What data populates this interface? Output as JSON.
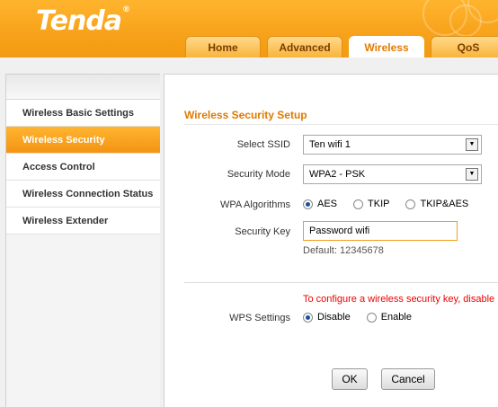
{
  "brand": {
    "logo_text": "Tenda",
    "trademark": "®"
  },
  "tabs": [
    {
      "label": "Home",
      "active": false
    },
    {
      "label": "Advanced",
      "active": false
    },
    {
      "label": "Wireless",
      "active": true
    },
    {
      "label": "QoS",
      "active": false
    }
  ],
  "sidebar": {
    "items": [
      {
        "label": "Wireless Basic Settings",
        "active": false
      },
      {
        "label": "Wireless Security",
        "active": true
      },
      {
        "label": "Access Control",
        "active": false
      },
      {
        "label": "Wireless Connection Status",
        "active": false
      },
      {
        "label": "Wireless Extender",
        "active": false
      }
    ]
  },
  "main": {
    "title": "Wireless Security Setup",
    "ssid": {
      "label": "Select SSID",
      "value": "Ten wifi 1"
    },
    "security_mode": {
      "label": "Security Mode",
      "value": "WPA2 - PSK"
    },
    "wpa_algorithms": {
      "label": "WPA Algorithms",
      "options": [
        "AES",
        "TKIP",
        "TKIP&AES"
      ],
      "selected": "AES"
    },
    "security_key": {
      "label": "Security Key",
      "value": "Password wifi",
      "default_text": "Default: 12345678"
    },
    "warning": "To configure a wireless security key, disable",
    "wps": {
      "label": "WPS Settings",
      "options": [
        "Disable",
        "Enable"
      ],
      "selected": "Disable"
    },
    "buttons": {
      "ok": "OK",
      "cancel": "Cancel"
    }
  },
  "colors": {
    "brand_orange": "#f7a21a",
    "title_orange": "#e07a00",
    "warning_red": "#e00000"
  }
}
